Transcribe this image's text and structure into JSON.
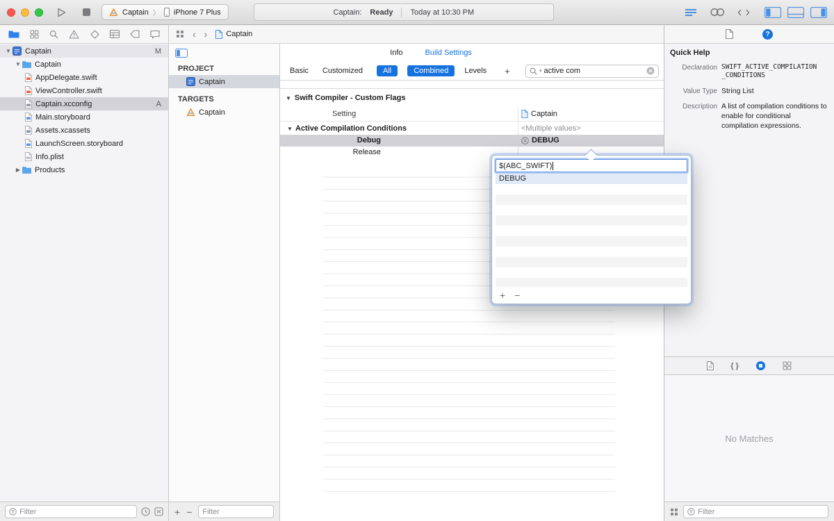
{
  "symbols": {
    "add": "+",
    "remove": "−",
    "open": "▼",
    "closed": "▶",
    "back": "‹",
    "forward": "›",
    "sep": "〉",
    "search_caret": "▾",
    "braces": "{ }"
  },
  "toolbar": {
    "scheme_name": "Captain",
    "device_name": "iPhone 7 Plus",
    "status_app": "Captain:",
    "status_state": "Ready",
    "status_time": "Today at 10:30 PM"
  },
  "jump_bar": {
    "file": "Captain"
  },
  "navigator": {
    "project": {
      "label": "Captain",
      "badge": "M"
    },
    "items": [
      {
        "label": "Captain"
      },
      {
        "label": "AppDelegate.swift"
      },
      {
        "label": "ViewController.swift"
      },
      {
        "label": "Captain.xcconfig",
        "badge": "A"
      },
      {
        "label": "Main.storyboard"
      },
      {
        "label": "Assets.xcassets"
      },
      {
        "label": "LaunchScreen.storyboard"
      },
      {
        "label": "Info.plist"
      },
      {
        "label": "Products"
      }
    ],
    "filter_placeholder": "Filter"
  },
  "project_panel": {
    "project_header": "PROJECT",
    "project_name": "Captain",
    "targets_header": "TARGETS",
    "target_name": "Captain",
    "filter_placeholder": "Filter"
  },
  "editor": {
    "tab_info": "Info",
    "tab_build_settings": "Build Settings",
    "scope_basic": "Basic",
    "scope_customized": "Customized",
    "scope_all": "All",
    "scope_combined": "Combined",
    "scope_levels": "Levels",
    "search_value": "active com",
    "section_title": "Swift Compiler - Custom Flags",
    "col_setting": "Setting",
    "col_target": "Captain",
    "row_group": {
      "name": "Active Compilation Conditions",
      "value": "<Multiple values>"
    },
    "row_debug": {
      "name": "Debug",
      "value": "DEBUG"
    },
    "row_release": {
      "name": "Release"
    }
  },
  "popover": {
    "field_value": "$(ABC_SWIFT)",
    "list": [
      {
        "label": "DEBUG"
      }
    ]
  },
  "inspector": {
    "title": "Quick Help",
    "declaration_label": "Declaration",
    "declaration_value": "SWIFT_ACTIVE_COMPILATION_CONDITIONS",
    "value_type_label": "Value Type",
    "value_type_value": "String List",
    "description_label": "Description",
    "description_value": "A list of compilation conditions to enable for conditional compilation expressions.",
    "no_matches": "No Matches",
    "filter_placeholder": "Filter"
  }
}
